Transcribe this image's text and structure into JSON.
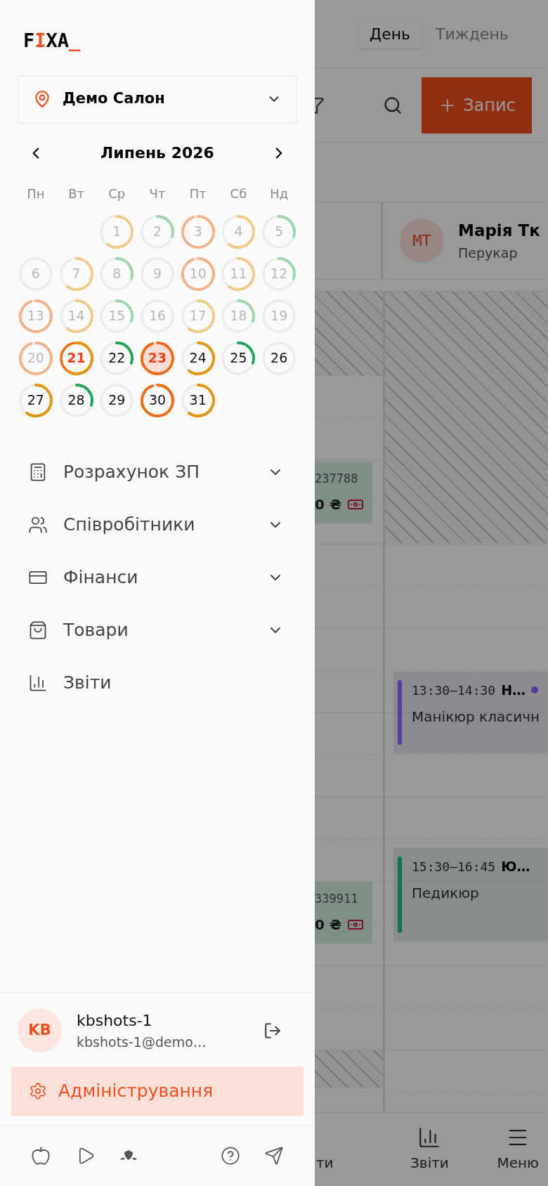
{
  "background": {
    "view_tabs": [
      {
        "label": "День",
        "selected": true
      },
      {
        "label": "Тиждень",
        "selected": false
      }
    ],
    "new_button": "Запис",
    "staff": {
      "initials": "МТ",
      "name": "Марія Тк",
      "role": "Перукар"
    },
    "column_1_cards": [
      {
        "code": "237788",
        "price": "0 ₴"
      },
      {
        "code": "339911",
        "price": "0 ₴"
      }
    ],
    "appointments": [
      {
        "time": "13:30–14:30",
        "client": "Н…",
        "service": "Манікюр класичн",
        "color": "#5a3c9c",
        "status": {
          "color": "#5a3c9c"
        }
      },
      {
        "time": "15:30–16:45",
        "client": "Ю…",
        "service": "Педикюр",
        "color": "#11744c"
      }
    ],
    "bottom_nav": [
      {
        "label": "ти"
      },
      {
        "label": "Звіти"
      },
      {
        "label": "Меню"
      }
    ]
  },
  "sidebar": {
    "logo": [
      {
        "text": "F",
        "accent": false
      },
      {
        "text": "I",
        "accent": true
      },
      {
        "text": "XA",
        "accent": false
      },
      {
        "text": "_",
        "accent": true
      }
    ],
    "location": {
      "name": "Демо Салон"
    },
    "calendar": {
      "month": "Липень 2026",
      "weekdays": [
        "Пн",
        "Вт",
        "Ср",
        "Чт",
        "Пт",
        "Сб",
        "Нд"
      ],
      "days": [
        {
          "day": "1",
          "kind": "medium",
          "past": true,
          "selected": false,
          "today": false
        },
        {
          "day": "2",
          "kind": "low",
          "past": true,
          "selected": false,
          "today": false
        },
        {
          "day": "3",
          "kind": "high",
          "past": true,
          "selected": false,
          "today": false
        },
        {
          "day": "4",
          "kind": "medium",
          "past": true,
          "selected": false,
          "today": false
        },
        {
          "day": "5",
          "kind": "low",
          "past": true,
          "selected": false,
          "today": false
        },
        {
          "day": "6",
          "kind": "none",
          "past": true,
          "selected": false,
          "today": false
        },
        {
          "day": "7",
          "kind": "medium",
          "past": true,
          "selected": false,
          "today": false
        },
        {
          "day": "8",
          "kind": "low",
          "past": true,
          "selected": false,
          "today": false
        },
        {
          "day": "9",
          "kind": "none",
          "past": true,
          "selected": false,
          "today": false
        },
        {
          "day": "10",
          "kind": "high",
          "past": true,
          "selected": false,
          "today": false
        },
        {
          "day": "11",
          "kind": "medium",
          "past": true,
          "selected": false,
          "today": false
        },
        {
          "day": "12",
          "kind": "low",
          "past": true,
          "selected": false,
          "today": false
        },
        {
          "day": "13",
          "kind": "high",
          "past": true,
          "selected": false,
          "today": false
        },
        {
          "day": "14",
          "kind": "medium",
          "past": true,
          "selected": false,
          "today": false
        },
        {
          "day": "15",
          "kind": "low",
          "past": true,
          "selected": false,
          "today": false
        },
        {
          "day": "16",
          "kind": "none",
          "past": true,
          "selected": false,
          "today": false
        },
        {
          "day": "17",
          "kind": "medium",
          "past": true,
          "selected": false,
          "today": false
        },
        {
          "day": "18",
          "kind": "low",
          "past": true,
          "selected": false,
          "today": false
        },
        {
          "day": "19",
          "kind": "none",
          "past": true,
          "selected": false,
          "today": false
        },
        {
          "day": "20",
          "kind": "high",
          "past": true,
          "selected": false,
          "today": false
        },
        {
          "day": "21",
          "kind": "medium",
          "past": false,
          "selected": false,
          "today": true
        },
        {
          "day": "22",
          "kind": "low",
          "past": false,
          "selected": false,
          "today": false
        },
        {
          "day": "23",
          "kind": "high",
          "past": false,
          "selected": true,
          "today": false
        },
        {
          "day": "24",
          "kind": "medium",
          "past": false,
          "selected": false,
          "today": false
        },
        {
          "day": "25",
          "kind": "low",
          "past": false,
          "selected": false,
          "today": false
        },
        {
          "day": "26",
          "kind": "none",
          "past": false,
          "selected": false,
          "today": false
        },
        {
          "day": "27",
          "kind": "medium",
          "past": false,
          "selected": false,
          "today": false
        },
        {
          "day": "28",
          "kind": "low",
          "past": false,
          "selected": false,
          "today": false
        },
        {
          "day": "29",
          "kind": "none",
          "past": false,
          "selected": false,
          "today": false
        },
        {
          "day": "30",
          "kind": "high",
          "past": false,
          "selected": false,
          "today": false
        },
        {
          "day": "31",
          "kind": "medium",
          "past": false,
          "selected": false,
          "today": false
        }
      ]
    },
    "menu": [
      {
        "label": "Розрахунок ЗП",
        "expanded": false
      },
      {
        "label": "Співробітники",
        "expanded": false
      },
      {
        "label": "Фінанси",
        "expanded": false
      },
      {
        "label": "Товари",
        "expanded": false
      },
      {
        "label": "Звіти"
      }
    ],
    "user": {
      "initials": "KB",
      "name": "kbshots-1",
      "email": "kbshots-1@demo…"
    },
    "admin": {
      "label": "Адміністрування"
    }
  }
}
